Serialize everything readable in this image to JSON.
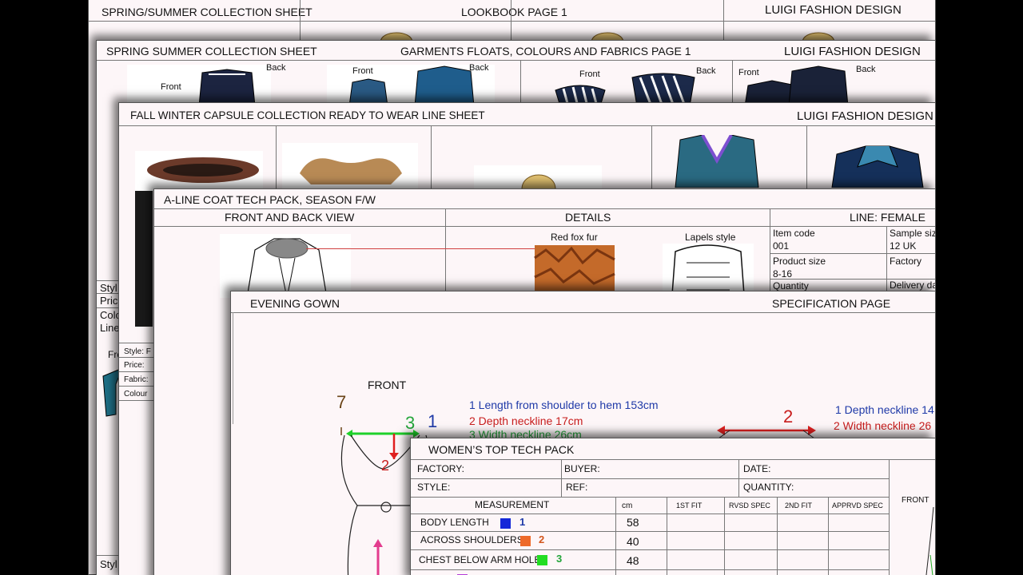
{
  "sheet1": {
    "title": "SPRING/SUMMER  COLLECTION SHEET",
    "center": "LOOKBOOK PAGE 1",
    "brand": "LUIGI FASHION DESIGN"
  },
  "sheet2": {
    "title": "SPRING SUMMER  COLLECTION SHEET",
    "center": "GARMENTS FLOATS, COLOURS AND FABRICS PAGE 1",
    "brand": "LUIGI FASHION DESIGN",
    "front": "Front",
    "back": "Back",
    "side_labels": [
      "Styl",
      "Pric",
      "Colo",
      "Line",
      "Fro",
      "Styl"
    ]
  },
  "sheet3": {
    "title": "FALL WINTER CAPSULE COLLECTION READY TO WEAR  LINE SHEET",
    "brand": "LUIGI FASHION DESIGN",
    "side_labels": [
      "Style: F",
      "Price:",
      "Fabric:",
      "Colour"
    ]
  },
  "sheet4": {
    "title": "A-LINE COAT  TECH PACK, SEASON F/W",
    "col1": "FRONT AND BACK VIEW",
    "col2": "DETAILS",
    "col3": "LINE: FEMALE",
    "detail1": "Red fox fur",
    "detail2": "Lapels style",
    "info": [
      {
        "label": "Item code",
        "value": "001"
      },
      {
        "label": "Sample size",
        "value": "12 UK"
      },
      {
        "label": "Product size",
        "value": "8-16"
      },
      {
        "label": "Factory",
        "value": ""
      },
      {
        "label": "Quantity",
        "value": ""
      },
      {
        "label": "Delivery da",
        "value": ""
      }
    ]
  },
  "sheet5": {
    "title": "EVENING GOWN",
    "right": "SPECIFICATION PAGE",
    "front": "FRONT",
    "markers": [
      "7",
      "3",
      "1",
      "2",
      "2"
    ],
    "notes_left": [
      "1 Length from shoulder to hem 153cm",
      "2 Depth neckline 17cm",
      "3 Width neckline 26cm"
    ],
    "notes_right": [
      "1 Depth neckline 14",
      "2 Width neckline 26"
    ]
  },
  "sheet6": {
    "title": "WOMEN’S TOP  TECH PACK",
    "factory": "FACTORY:",
    "buyer": "BUYER:",
    "date": "DATE:",
    "style": "STYLE:",
    "ref": "REF:",
    "quantity": "QUANTITY:",
    "front": "FRONT",
    "headers": [
      "MEASUREMENT",
      "cm",
      "1ST FIT",
      "RVSD SPEC",
      "2ND FIT",
      "APPRVD SPEC"
    ],
    "rows": [
      {
        "name": "BODY LENGTH",
        "num": "1",
        "color": "#1428d8",
        "numColor": "#1f3aa8",
        "cm": "58"
      },
      {
        "name": "ACROSS SHOULDERS",
        "num": "2",
        "color": "#ee6a2a",
        "numColor": "#d2561d",
        "cm": "40"
      },
      {
        "name": "CHEST BELOW ARM HOLE",
        "num": "3",
        "color": "#22dd22",
        "numColor": "#23a53a",
        "cm": "48"
      }
    ]
  }
}
